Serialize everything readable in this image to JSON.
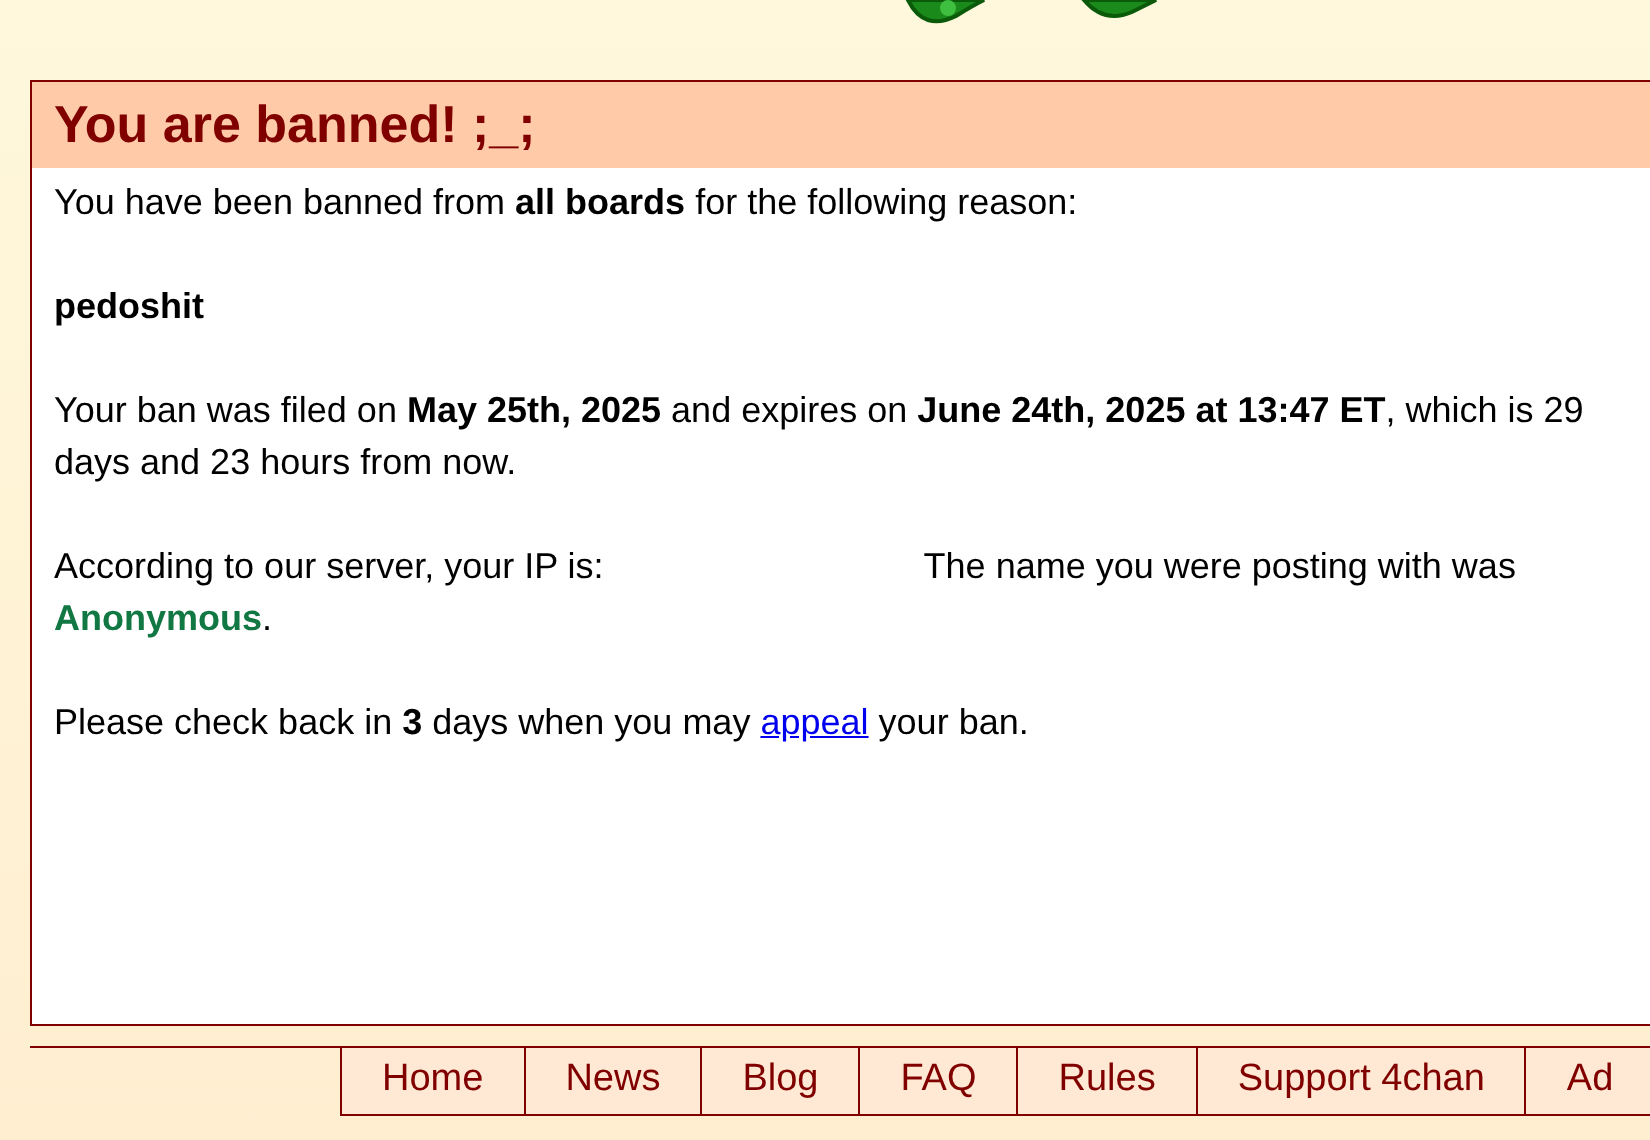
{
  "ban": {
    "title": "You are banned! ;_;",
    "intro": "You have been banned from **all boards** for the following reason:",
    "reason": "pedoshit",
    "filed": "Your ban was filed on **May 25th, 2025** and expires on **June 24th, 2025 at 13:47 ET**, which is 29 days and 23 hours from now.",
    "ip_label": "According to our server, your IP is:",
    "name_label": "The name you were posting with was",
    "name": "Anonymous",
    "name_end": ".",
    "appeal_before": "Please check back in **3** days when you may",
    "appeal_link": "appeal",
    "appeal_after": "your ban."
  },
  "footer_nav": [
    "Home",
    "News",
    "Blog",
    "FAQ",
    "Rules",
    "Support 4chan",
    "Ad"
  ]
}
